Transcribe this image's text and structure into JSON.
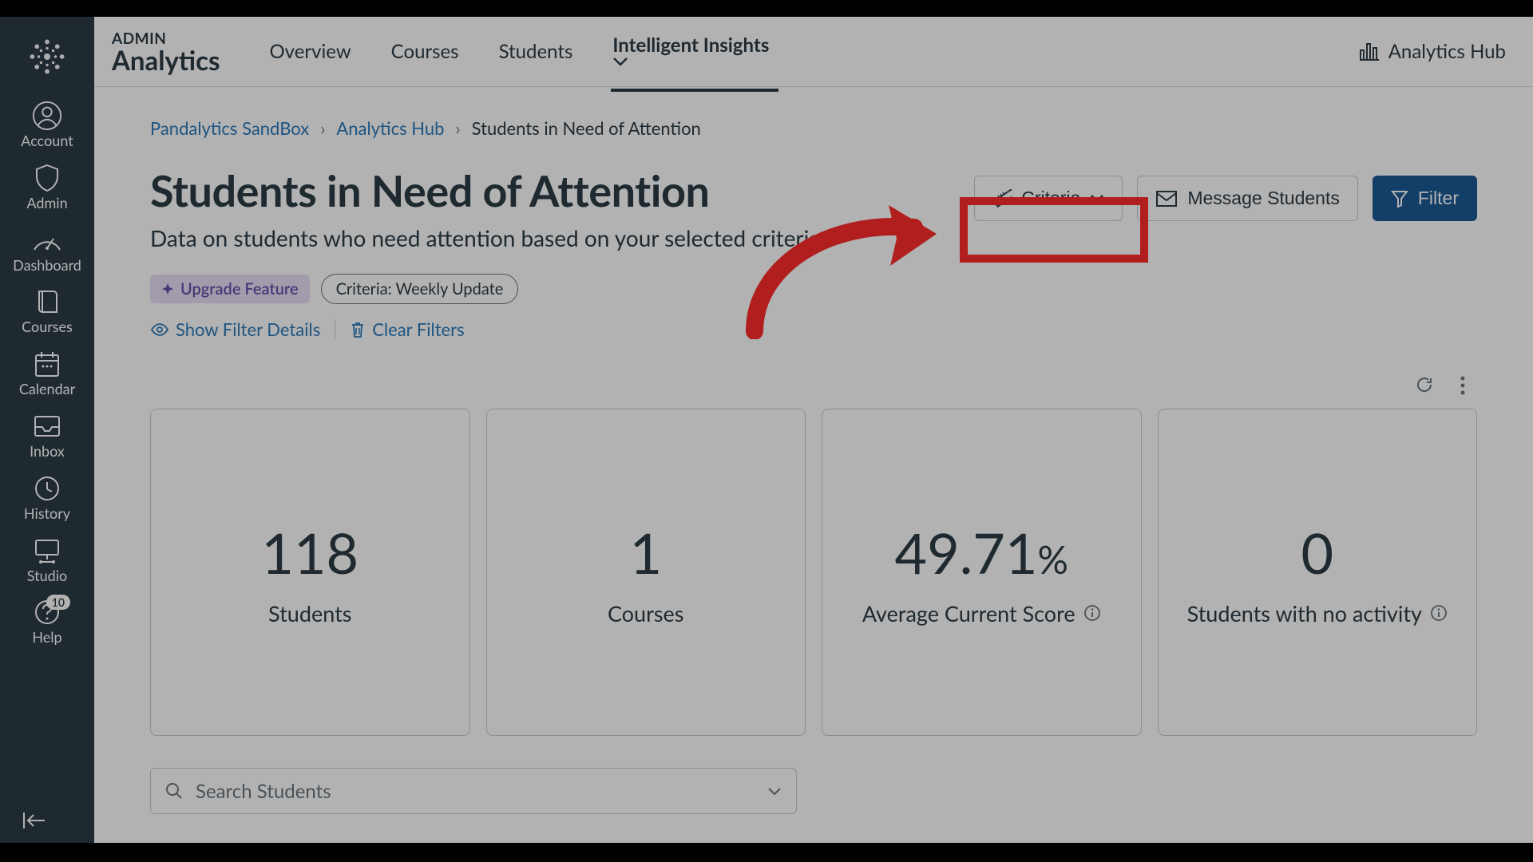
{
  "sidebar": {
    "items": [
      {
        "label": "Account"
      },
      {
        "label": "Admin"
      },
      {
        "label": "Dashboard"
      },
      {
        "label": "Courses"
      },
      {
        "label": "Calendar"
      },
      {
        "label": "Inbox"
      },
      {
        "label": "History"
      },
      {
        "label": "Studio"
      },
      {
        "label": "Help",
        "badge": "10"
      }
    ]
  },
  "header": {
    "brand_top": "ADMIN",
    "brand_bottom": "Analytics",
    "tabs": [
      "Overview",
      "Courses",
      "Students",
      "Intelligent Insights"
    ],
    "active_tab": "Intelligent Insights",
    "hub_label": "Analytics Hub"
  },
  "breadcrumbs": {
    "items": [
      "Pandalytics SandBox",
      "Analytics Hub",
      "Students in Need of Attention"
    ]
  },
  "page": {
    "title": "Students in Need of Attention",
    "subtitle": "Data on students who need attention based on your selected criteria."
  },
  "actions": {
    "criteria": "Criteria",
    "message": "Message Students",
    "filter": "Filter"
  },
  "chips": {
    "upgrade": "Upgrade Feature",
    "criteria_chip": "Criteria: Weekly Update"
  },
  "filter_links": {
    "show": "Show Filter Details",
    "clear": "Clear Filters"
  },
  "metrics": [
    {
      "value": "118",
      "label": "Students",
      "info": false
    },
    {
      "value": "1",
      "label": "Courses",
      "info": false
    },
    {
      "value": "49.71",
      "suffix": "%",
      "label": "Average Current Score",
      "info": true
    },
    {
      "value": "0",
      "label": "Students with no activity",
      "info": true
    }
  ],
  "search": {
    "placeholder": "Search Students"
  }
}
